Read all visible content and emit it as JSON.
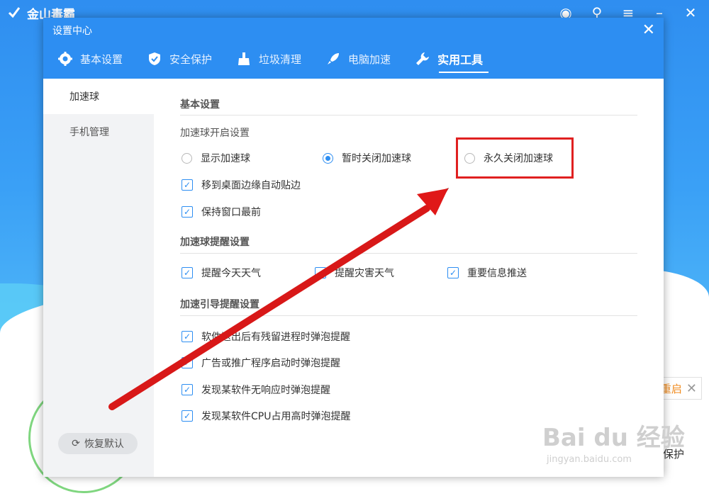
{
  "app": {
    "title": "金山毒霸"
  },
  "background": {
    "restart_text": "重启",
    "restart_close": "✕",
    "protect_text": "保护"
  },
  "dialog": {
    "title": "设置中心",
    "close": "✕",
    "tabs": [
      {
        "label": "基本设置",
        "icon": "gear-icon"
      },
      {
        "label": "安全保护",
        "icon": "shield-icon"
      },
      {
        "label": "垃圾清理",
        "icon": "broom-icon"
      },
      {
        "label": "电脑加速",
        "icon": "rocket-icon"
      },
      {
        "label": "实用工具",
        "icon": "wrench-icon",
        "active": true
      }
    ],
    "sidebar": {
      "items": [
        {
          "label": "加速球",
          "active": true
        },
        {
          "label": "手机管理",
          "active": false
        }
      ],
      "reset_label": "恢复默认"
    },
    "content": {
      "sections": [
        {
          "title": "基本设置"
        },
        {
          "title": "加速球提醒设置"
        },
        {
          "title": "加速引导提醒设置"
        }
      ],
      "group_label": "加速球开启设置",
      "radios": [
        {
          "label": "显示加速球",
          "checked": false
        },
        {
          "label": "暂时关闭加速球",
          "checked": true
        },
        {
          "label": "永久关闭加速球",
          "checked": false
        }
      ],
      "basic_checks": [
        {
          "label": "移到桌面边缘自动贴边",
          "checked": true
        },
        {
          "label": "保持窗口最前",
          "checked": true
        }
      ],
      "reminder_checks": [
        {
          "label": "提醒今天天气",
          "checked": true
        },
        {
          "label": "提醒灾害天气",
          "checked": true
        },
        {
          "label": "重要信息推送",
          "checked": true
        }
      ],
      "guide_checks": [
        {
          "label": "软件退出后有残留进程时弹泡提醒",
          "checked": true
        },
        {
          "label": "广告或推广程序启动时弹泡提醒",
          "checked": true
        },
        {
          "label": "发现某软件无响应时弹泡提醒",
          "checked": true
        },
        {
          "label": "发现某软件CPU占用高时弹泡提醒",
          "checked": true
        }
      ]
    }
  },
  "watermark": {
    "logo": "Bai du 经验",
    "url": "jingyan.baidu.com"
  },
  "colors": {
    "accent": "#2d8ef2",
    "annotation": "#e02020"
  }
}
